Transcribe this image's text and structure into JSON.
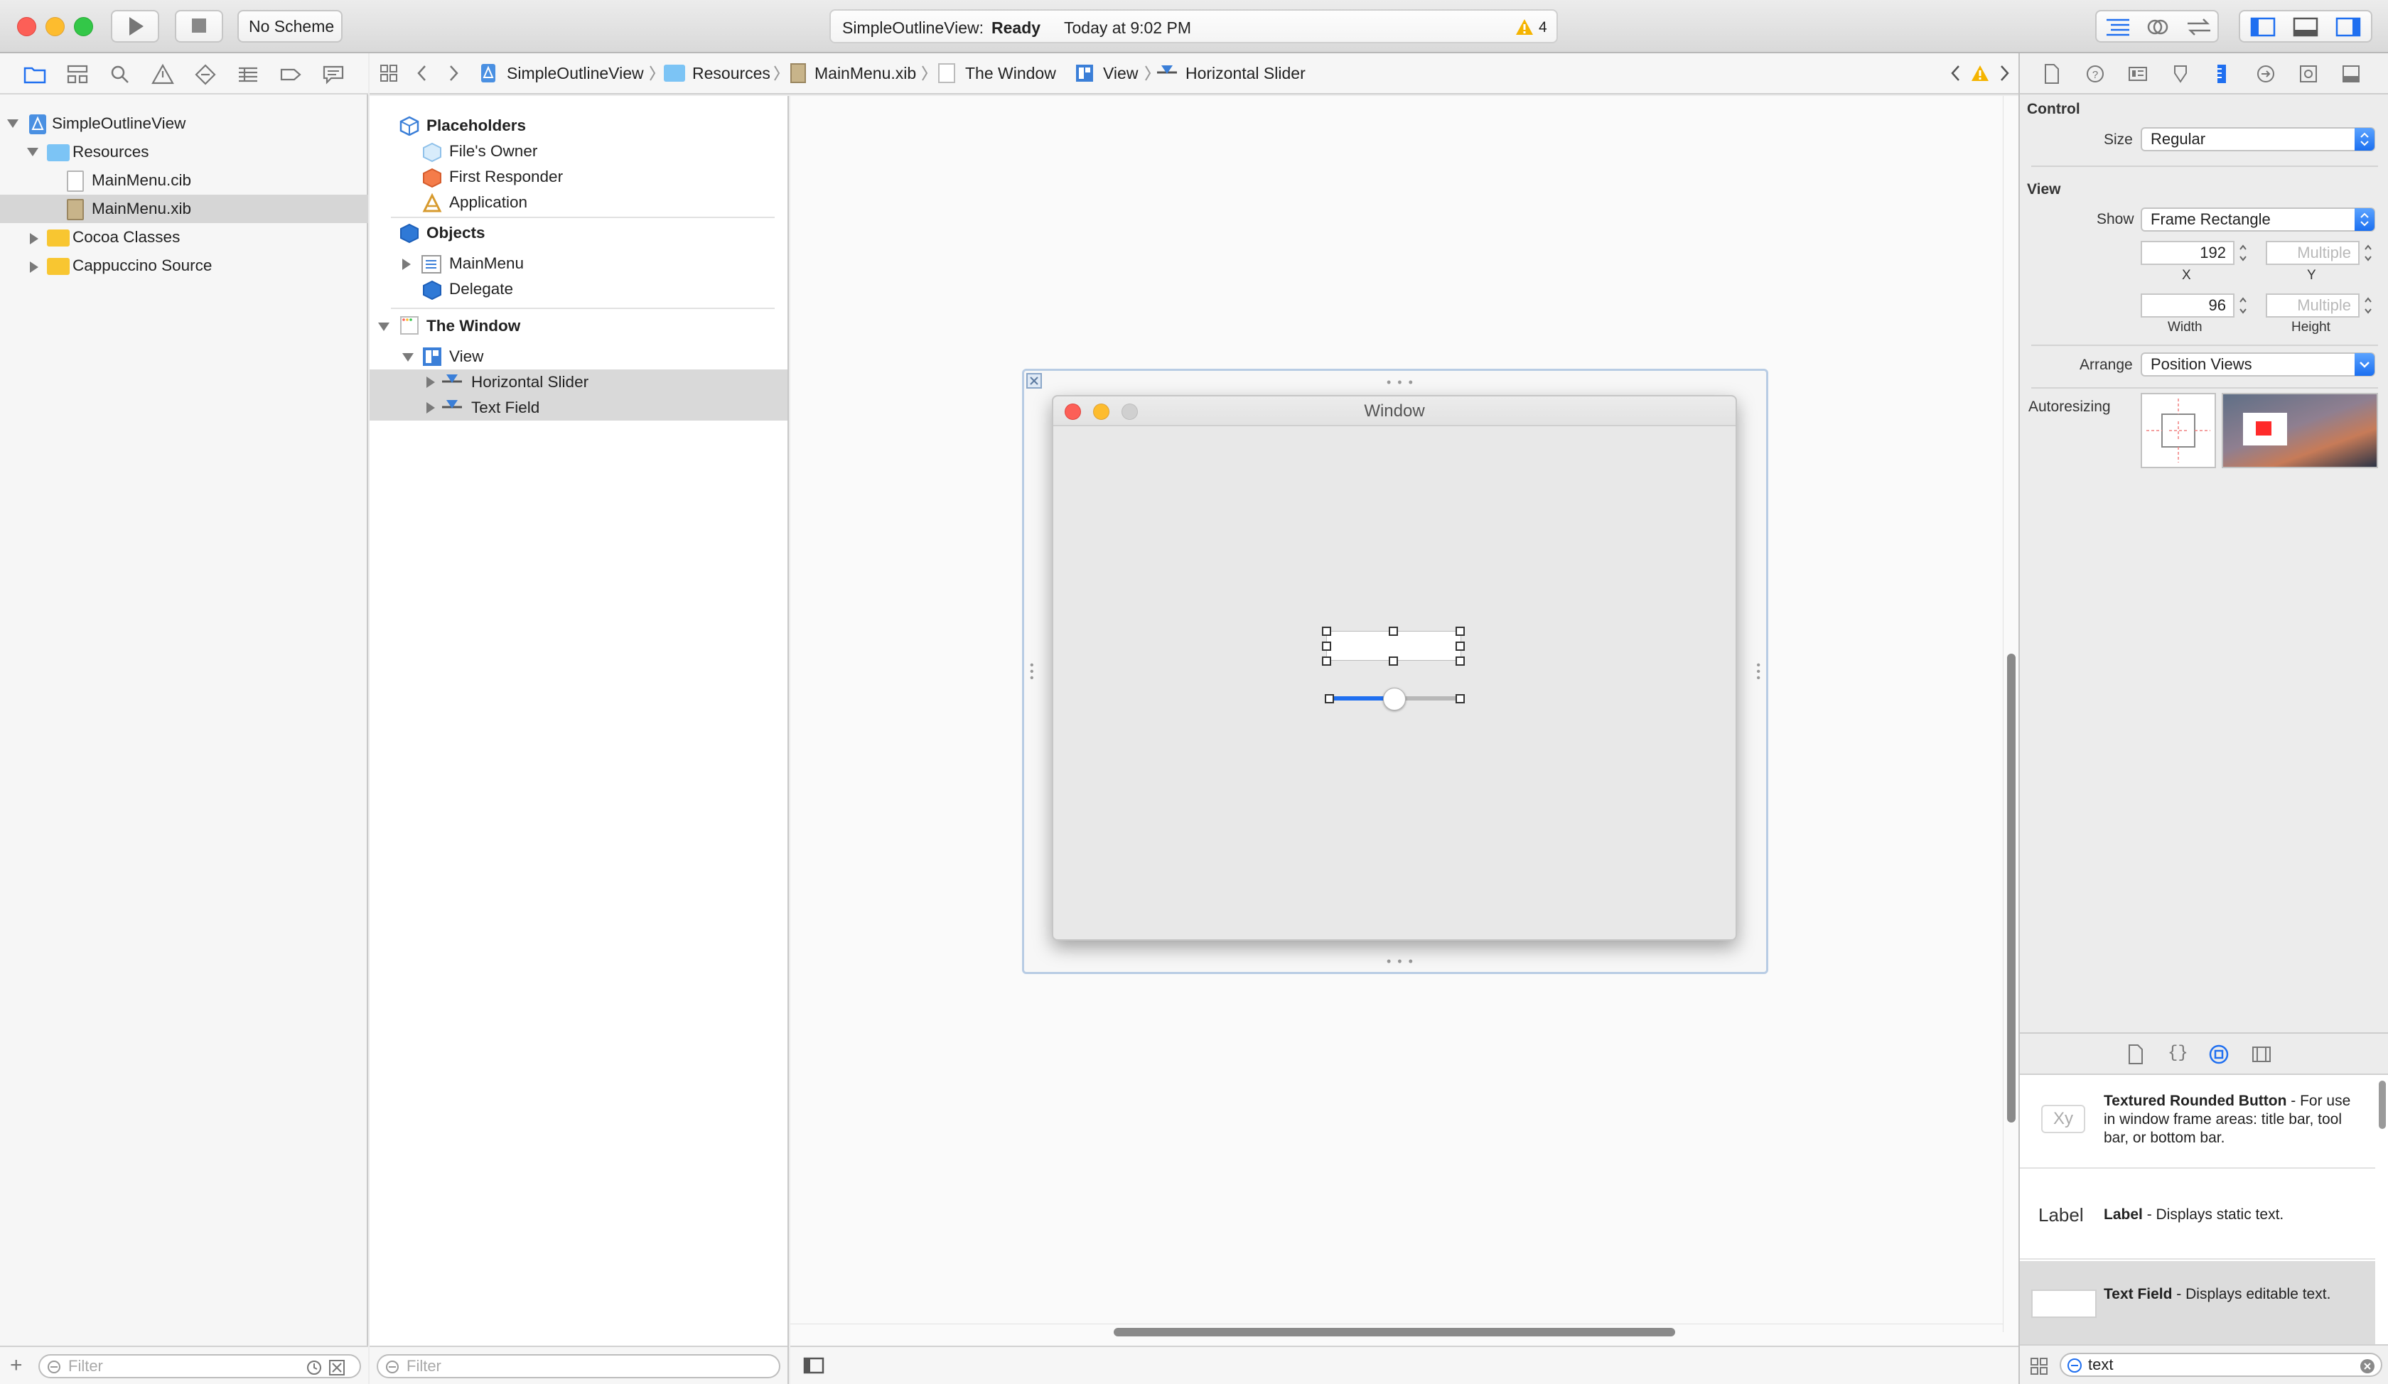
{
  "toolbar": {
    "scheme": "No Scheme",
    "activity_project": "SimpleOutlineView:",
    "activity_status": "Ready",
    "activity_time": "Today at 9:02 PM",
    "warning_count": "4"
  },
  "navigator": {
    "items": [
      {
        "label": "SimpleOutlineView"
      },
      {
        "label": "Resources"
      },
      {
        "label": "MainMenu.cib"
      },
      {
        "label": "MainMenu.xib"
      },
      {
        "label": "Cocoa Classes"
      },
      {
        "label": "Cappuccino Source"
      }
    ],
    "filter_placeholder": "Filter"
  },
  "jumpbar": {
    "crumbs": [
      "SimpleOutlineView",
      "Resources",
      "MainMenu.xib",
      "The Window",
      "View",
      "Horizontal Slider"
    ]
  },
  "outline": {
    "placeholders_header": "Placeholders",
    "placeholders": [
      "File's Owner",
      "First Responder",
      "Application"
    ],
    "objects_header": "Objects",
    "objects": [
      "MainMenu",
      "Delegate"
    ],
    "window_header": "The Window",
    "view_label": "View",
    "view_children": [
      "Horizontal Slider",
      "Text Field"
    ],
    "filter_placeholder": "Filter"
  },
  "canvas": {
    "window_title": "Window",
    "slider_value_fraction": 0.5
  },
  "inspector": {
    "control_header": "Control",
    "size_label": "Size",
    "size_value": "Regular",
    "view_header": "View",
    "show_label": "Show",
    "show_value": "Frame Rectangle",
    "x_value": "192",
    "y_value": "Multiple",
    "x_label": "X",
    "y_label": "Y",
    "width_value": "96",
    "height_value": "Multiple",
    "width_label": "Width",
    "height_label": "Height",
    "arrange_label": "Arrange",
    "arrange_value": "Position Views",
    "autoresizing_label": "Autoresizing"
  },
  "library": {
    "items": [
      {
        "preview": "Xy",
        "title": "Textured Rounded Button",
        "desc": " - For use in window frame areas: title bar, tool bar, or bottom bar."
      },
      {
        "preview": "Label",
        "title": "Label",
        "desc": " - Displays static text."
      },
      {
        "preview": "",
        "title": "Text Field",
        "desc": " - Displays editable text."
      }
    ],
    "search_value": "text"
  },
  "colors": {
    "accent": "#1f6ff0",
    "selection": "#d6d6d6",
    "close": "#fc5f57",
    "minimize": "#fdbc2e",
    "zoom": "#33c748",
    "warning": "#f5b400",
    "folder": "#f8c631"
  }
}
